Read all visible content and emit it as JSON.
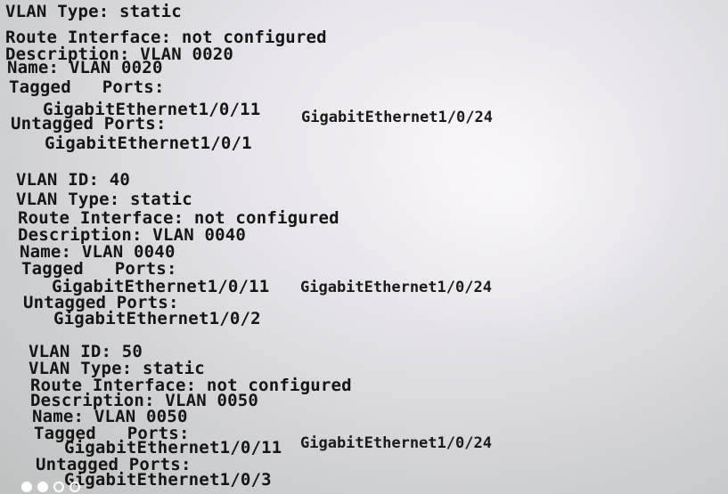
{
  "block0": {
    "vlan_type": "VLAN Type: static",
    "route_interface": "Route Interface: not configured",
    "description": "Description: VLAN 0020",
    "name": "Name: VLAN 0020",
    "tagged_header": "Tagged   Ports:",
    "tagged_port_1": "GigabitEthernet1/0/11",
    "tagged_port_2": "GigabitEthernet1/0/24",
    "untagged_header": "Untagged Ports:",
    "untagged_port_1": "GigabitEthernet1/0/1"
  },
  "block1": {
    "vlan_id": "VLAN ID: 40",
    "vlan_type": "VLAN Type: static",
    "route_interface": "Route Interface: not configured",
    "description": "Description: VLAN 0040",
    "name": "Name: VLAN 0040",
    "tagged_header": "Tagged   Ports:",
    "tagged_port_1": "GigabitEthernet1/0/11",
    "tagged_port_2": "GigabitEthernet1/0/24",
    "untagged_header": "Untagged Ports:",
    "untagged_port_1": "GigabitEthernet1/0/2"
  },
  "block2": {
    "vlan_id": "VLAN ID: 50",
    "vlan_type": "VLAN Type: static",
    "route_interface": "Route Interface: not configured",
    "description": "Description: VLAN 0050",
    "name": "Name: VLAN 0050",
    "tagged_header": "Tagged   Ports:",
    "tagged_port_1": "GigabitEthernet1/0/11",
    "tagged_port_2": "GigabitEthernet1/0/24",
    "untagged_header": "Untagged Ports:",
    "untagged_port_1": "GigabitEthernet1/0/3"
  },
  "carousel": {
    "dots": [
      "filled",
      "filled",
      "hollow",
      "hollow"
    ]
  }
}
